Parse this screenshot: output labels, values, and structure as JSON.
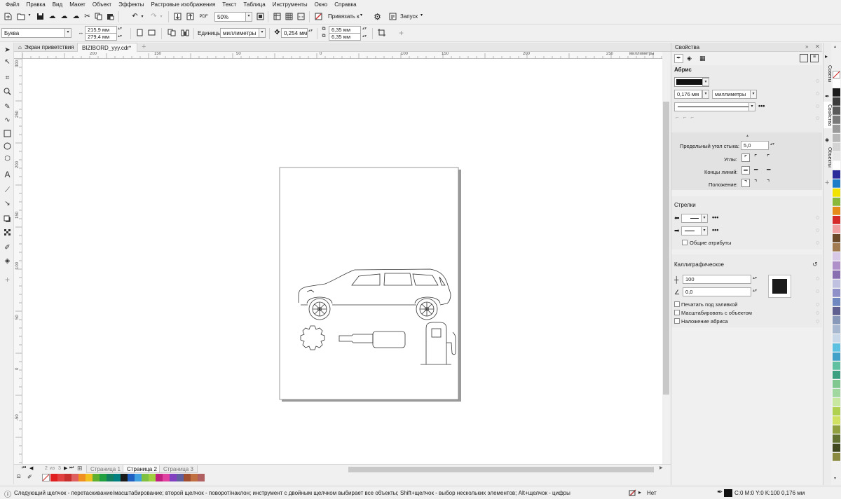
{
  "menu": [
    "Файл",
    "Правка",
    "Вид",
    "Макет",
    "Объект",
    "Эффекты",
    "Растровые изображения",
    "Текст",
    "Таблица",
    "Инструменты",
    "Окно",
    "Справка"
  ],
  "toolbar": {
    "zoom": "50%",
    "snap_label": "Привязать к",
    "launch_label": "Запуск",
    "pdf_label": "PDF"
  },
  "propbar": {
    "paper_preset": "Буква",
    "width": "215,9 мм",
    "height": "279,4 мм",
    "units_label": "Единицы:",
    "units_value": "миллиметры",
    "nudge": "0,254 мм",
    "dup_x": "6,35 мм",
    "dup_y": "6,35 мм"
  },
  "tabs": {
    "welcome": "Экран приветствия",
    "document": "BIZIBORD_yyy.cdr*",
    "add": "+"
  },
  "ruler": {
    "h_labels": [
      "250",
      "200",
      "150",
      "100",
      "50",
      "0",
      "50",
      "100",
      "150",
      "200",
      "250"
    ],
    "h_unit": "миллиметры",
    "v_labels": [
      "300",
      "250",
      "200",
      "150",
      "100",
      "50",
      "0",
      "-50"
    ]
  },
  "pagenav": {
    "counter": "2",
    "of": "из",
    "total": "3",
    "pages": [
      "Страница 1",
      "Страница 2",
      "Страница 3"
    ],
    "active": 1
  },
  "status": {
    "hint": "Следующий щелчок - перетаскивание/масштабирование; второй щелчок - поворот/наклон; инструмент с двойным щелчком выбирает все объекты; Shift+щелчок - выбор нескольких элементов; Alt+щелчок - цифры",
    "fill": "Нет",
    "outline": "C:0 M:0 Y:0 K:100  0,176 мм"
  },
  "panel": {
    "title": "Свойства",
    "outline_heading": "Абрис",
    "outline_color": "#111111",
    "width": "0,176 мм",
    "units": "миллиметры",
    "miter_label": "Предельный угол стыка:",
    "miter_value": "5,0",
    "corners_label": "Углы:",
    "caps_label": "Концы линий:",
    "position_label": "Положение:",
    "arrows_heading": "Стрелки",
    "shared_attrs": "Общие атрибуты",
    "calligraphic_heading": "Каллиграфическое",
    "stretch_value": "100",
    "angle_value": "0,0",
    "print_under_fill": "Печатать под заливкой",
    "scale_with_object": "Масштабировать с объектом",
    "overprint": "Наложение абриса"
  },
  "side_tabs": [
    "Советы",
    "Свойства",
    "Объекты"
  ],
  "palette_colors": [
    "#ffffff",
    "#1a1a1a",
    "#3b3b3b",
    "#5a5a5a",
    "#7a7a7a",
    "#9a9a9a",
    "#b8b8b8",
    "#d4d4d4",
    "#e8e8e8",
    "#ffffff",
    "#2a2a9a",
    "#1c7cc8",
    "#f2e200",
    "#8ab83a",
    "#e58b1a",
    "#d42a2a",
    "#f0a0a0",
    "#6b4a2a",
    "#a07a50",
    "#d8c8e8",
    "#b090c8",
    "#8870b0",
    "#c0c0e0",
    "#9090c8",
    "#7088c0",
    "#606090",
    "#8898b8",
    "#a8b8d0",
    "#c8d8e8",
    "#5cc0e0",
    "#40a0c8",
    "#60c0a0",
    "#3ca080",
    "#80c890",
    "#a0d8a0",
    "#c8e8a0",
    "#b0d050",
    "#d0e060",
    "#90a040",
    "#607030",
    "#404820",
    "#8a8a40"
  ],
  "bottom_palette": [
    "#e02020",
    "#e04040",
    "#c83030",
    "#e06060",
    "#f09020",
    "#f0c020",
    "#60b030",
    "#20a040",
    "#108060",
    "#008080",
    "#1a1a1a",
    "#2060c0",
    "#40a0e0",
    "#80c040",
    "#a0d040",
    "#c02080",
    "#e040a0",
    "#8040c0",
    "#6060a0",
    "#a05030",
    "#c07040",
    "#b06060"
  ]
}
